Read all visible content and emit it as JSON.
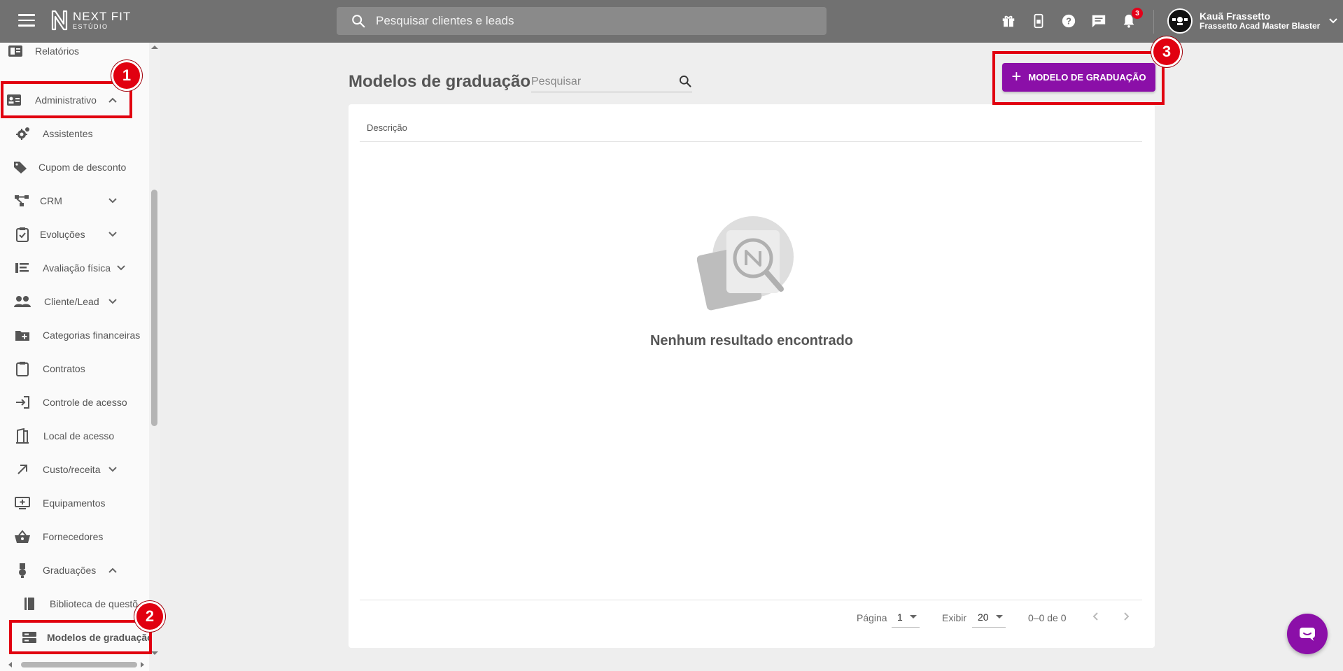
{
  "topbar": {
    "logo_line1": "NEXT FIT",
    "logo_line2": "ESTÚDIO",
    "search_placeholder": "Pesquisar clientes e leads",
    "icons": [
      "gift-icon",
      "phone-icon",
      "help-icon",
      "chat-icon",
      "bell-icon"
    ],
    "notification_count": "3",
    "user_name": "Kauã Frassetto",
    "user_subtitle": "Frassetto Acad Master Blaster"
  },
  "sidebar": {
    "items": [
      {
        "label": "Relatórios",
        "icon": "report-icon"
      },
      {
        "label": "Administrativo",
        "icon": "admin-card-icon"
      },
      {
        "label": "Assistentes",
        "icon": "gear-icon"
      },
      {
        "label": "Cupom de desconto",
        "icon": "tag-icon"
      },
      {
        "label": "CRM",
        "icon": "crm-icon"
      },
      {
        "label": "Evoluções",
        "icon": "clipboard-icon"
      },
      {
        "label": "Avaliação física",
        "icon": "ruler-icon"
      },
      {
        "label": "Cliente/Lead",
        "icon": "people-icon"
      },
      {
        "label": "Categorias financeiras",
        "icon": "folder-add-icon"
      },
      {
        "label": "Contratos",
        "icon": "clipboard-blank-icon"
      },
      {
        "label": "Controle de acesso",
        "icon": "login-icon"
      },
      {
        "label": "Local de acesso",
        "icon": "door-icon"
      },
      {
        "label": "Custo/receita",
        "icon": "arrow-up-right-icon"
      },
      {
        "label": "Equipamentos",
        "icon": "equipment-icon"
      },
      {
        "label": "Fornecedores",
        "icon": "basket-icon"
      },
      {
        "label": "Graduações",
        "icon": "medal-icon"
      },
      {
        "label": "Biblioteca de questõ",
        "icon": "book-icon"
      },
      {
        "label": "Modelos de graduação",
        "icon": "storage-icon"
      }
    ]
  },
  "annotations": {
    "m1": "1",
    "m2": "2",
    "m3": "3"
  },
  "main": {
    "title": "Modelos de graduação",
    "search_placeholder": "Pesquisar",
    "add_button_label": "MODELO DE GRADUAÇÃO",
    "column_header": "Descrição",
    "empty_message": "Nenhum resultado encontrado",
    "pagination": {
      "page_label": "Página",
      "page_value": "1",
      "show_label": "Exibir",
      "show_value": "20",
      "range": "0–0 de 0"
    }
  },
  "colors": {
    "topbar": "#717171",
    "accent": "#8b0fa8",
    "annotation": "#e10010"
  }
}
